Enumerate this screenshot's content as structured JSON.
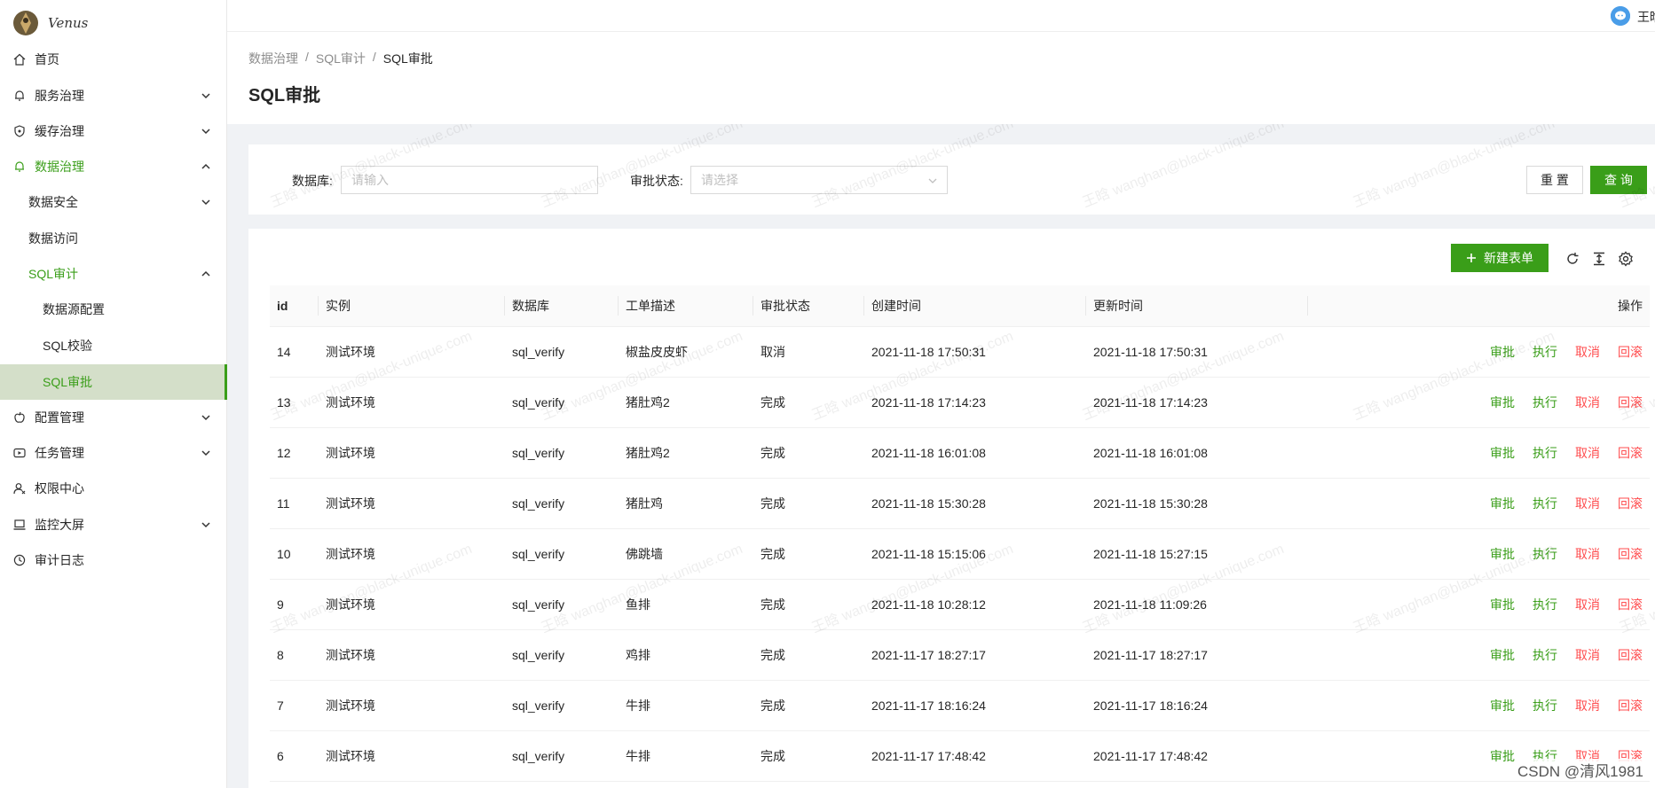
{
  "app": {
    "logo_text": "Venus",
    "user_name": "王晗"
  },
  "sidebar": {
    "items": [
      {
        "label": "首页",
        "icon": "home-icon"
      },
      {
        "label": "服务治理",
        "icon": "bell-icon"
      },
      {
        "label": "缓存治理",
        "icon": "shield-icon"
      },
      {
        "label": "数据治理",
        "icon": "bell-icon"
      },
      {
        "label": "数据安全"
      },
      {
        "label": "数据访问"
      },
      {
        "label": "SQL审计"
      },
      {
        "label": "数据源配置"
      },
      {
        "label": "SQL校验"
      },
      {
        "label": "SQL审批"
      },
      {
        "label": "配置管理",
        "icon": "apple-icon"
      },
      {
        "label": "任务管理",
        "icon": "play-icon"
      },
      {
        "label": "权限中心",
        "icon": "user-icon"
      },
      {
        "label": "监控大屏",
        "icon": "monitor-icon"
      },
      {
        "label": "审计日志",
        "icon": "clock-icon"
      }
    ]
  },
  "breadcrumb": [
    "数据治理",
    "SQL审计",
    "SQL审批"
  ],
  "breadcrumb_sep": "/",
  "page_title": "SQL审批",
  "search": {
    "db_label": "数据库:",
    "db_placeholder": "请输入",
    "status_label": "审批状态:",
    "status_placeholder": "请选择",
    "reset_label": "重 置",
    "query_label": "查 询"
  },
  "toolbar": {
    "new_label": "新建表单"
  },
  "table": {
    "columns": [
      "id",
      "实例",
      "数据库",
      "工单描述",
      "审批状态",
      "创建时间",
      "更新时间",
      "操作"
    ],
    "actions": [
      "审批",
      "执行",
      "取消",
      "回滚"
    ],
    "rows": [
      [
        "14",
        "测试环境",
        "sql_verify",
        "椒盐皮皮虾",
        "取消",
        "2021-11-18 17:50:31",
        "2021-11-18 17:50:31"
      ],
      [
        "13",
        "测试环境",
        "sql_verify",
        "猪肚鸡2",
        "完成",
        "2021-11-18 17:14:23",
        "2021-11-18 17:14:23"
      ],
      [
        "12",
        "测试环境",
        "sql_verify",
        "猪肚鸡2",
        "完成",
        "2021-11-18 16:01:08",
        "2021-11-18 16:01:08"
      ],
      [
        "11",
        "测试环境",
        "sql_verify",
        "猪肚鸡",
        "完成",
        "2021-11-18 15:30:28",
        "2021-11-18 15:30:28"
      ],
      [
        "10",
        "测试环境",
        "sql_verify",
        "佛跳墙",
        "完成",
        "2021-11-18 15:15:06",
        "2021-11-18 15:27:15"
      ],
      [
        "9",
        "测试环境",
        "sql_verify",
        "鱼排",
        "完成",
        "2021-11-18 10:28:12",
        "2021-11-18 11:09:26"
      ],
      [
        "8",
        "测试环境",
        "sql_verify",
        "鸡排",
        "完成",
        "2021-11-17 18:27:17",
        "2021-11-17 18:27:17"
      ],
      [
        "7",
        "测试环境",
        "sql_verify",
        "牛排",
        "完成",
        "2021-11-17 18:16:24",
        "2021-11-17 18:16:24"
      ],
      [
        "6",
        "测试环境",
        "sql_verify",
        "牛排",
        "完成",
        "2021-11-17 17:48:42",
        "2021-11-17 17:48:42"
      ]
    ]
  },
  "watermark": "王晗 wanghan@black-unique.com",
  "credit": "CSDN @清风1981",
  "colors": {
    "accent": "#3a9e19",
    "danger": "#ff4d4f",
    "selected_bg": "#d4dfc9"
  }
}
